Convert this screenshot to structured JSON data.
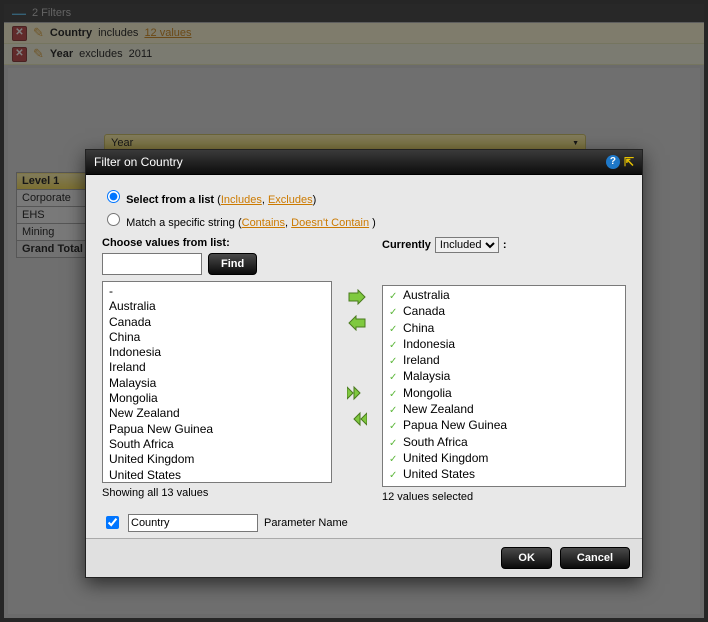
{
  "filters_header": "2 Filters",
  "filter_rows": {
    "row1_field": "Country",
    "row1_verb": "includes",
    "row1_values": "12 values",
    "row2_field": "Year",
    "row2_verb": "excludes",
    "row2_value": "2011"
  },
  "year_select_label": "Year",
  "left_table": {
    "header": "Level 1",
    "rows": [
      "Corporate",
      "EHS",
      "Mining"
    ],
    "total": "Grand Total"
  },
  "dialog": {
    "title": "Filter on Country",
    "radio1_label": "Select from a list",
    "radio1_link1": "Includes",
    "radio1_link2": "Excludes",
    "radio2_label": "Match a specific string",
    "radio2_link1": "Contains",
    "radio2_link2": "Doesn't Contain",
    "choose_label": "Choose values from list:",
    "find_label": "Find",
    "currently_label": "Currently",
    "currently_value": "Included",
    "colon": ":",
    "source_list": [
      "-",
      "Australia",
      "Canada",
      "China",
      "Indonesia",
      "Ireland",
      "Malaysia",
      "Mongolia",
      "New Zealand",
      "Papua New Guinea",
      "South Africa",
      "United Kingdom",
      "United States"
    ],
    "source_status": "Showing all 13 values",
    "selected_list": [
      "Australia",
      "Canada",
      "China",
      "Indonesia",
      "Ireland",
      "Malaysia",
      "Mongolia",
      "New Zealand",
      "Papua New Guinea",
      "South Africa",
      "United Kingdom",
      "United States"
    ],
    "selected_status": "12 values selected",
    "param_checked": true,
    "param_value": "Country",
    "param_label": "Parameter Name",
    "ok": "OK",
    "cancel": "Cancel"
  }
}
